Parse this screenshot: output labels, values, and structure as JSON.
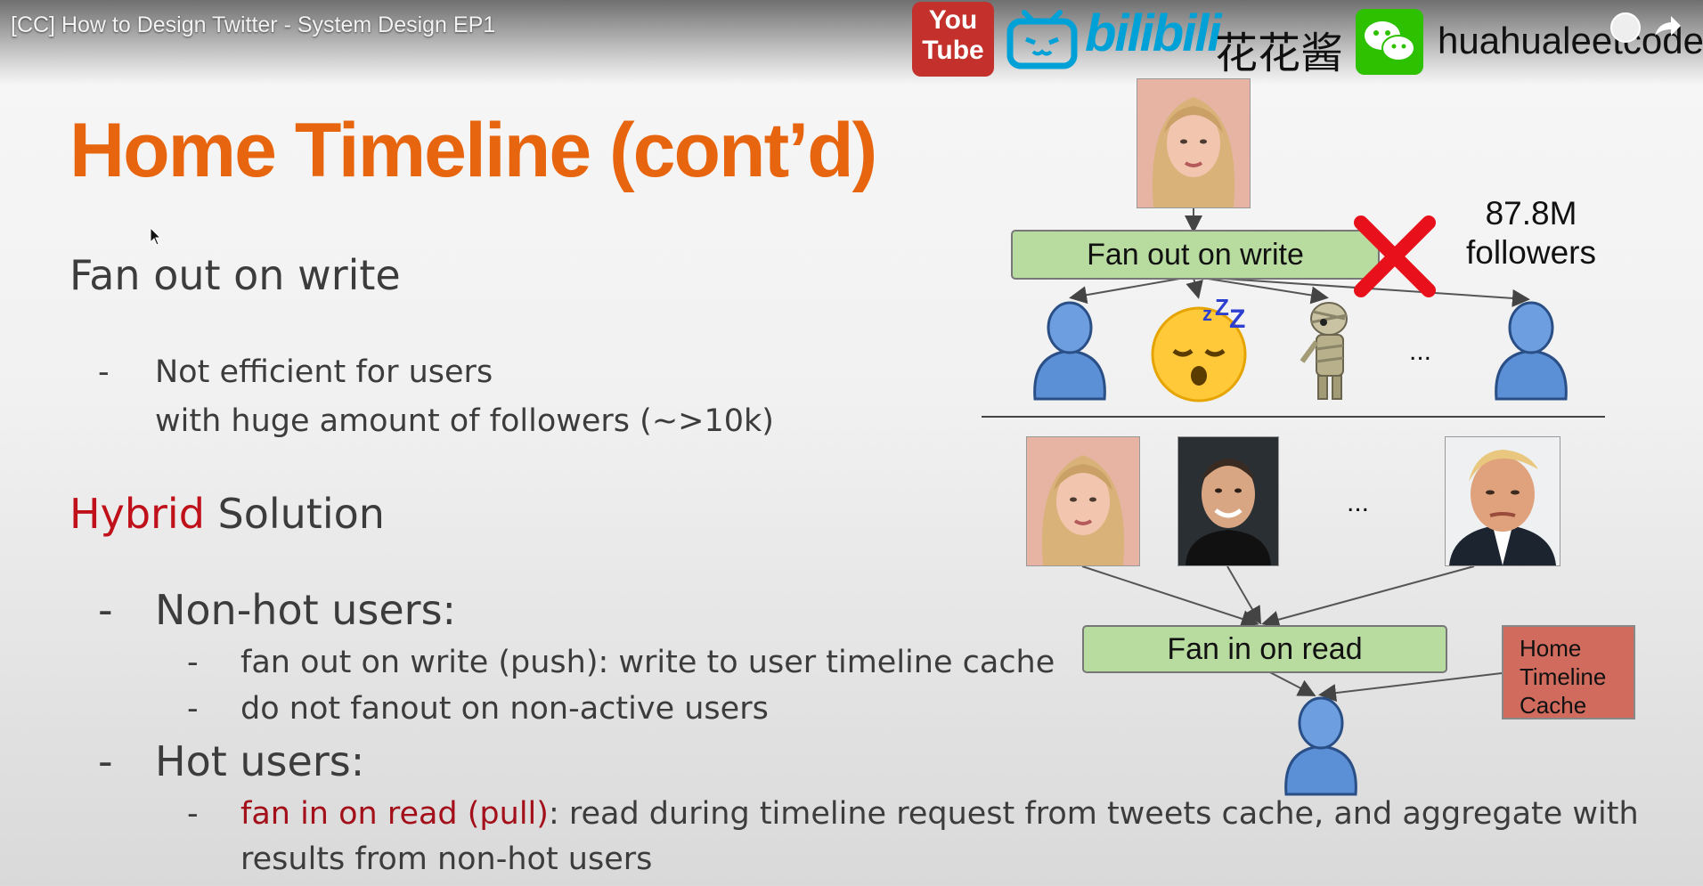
{
  "video": {
    "title": "[CC] How to Design Twitter - System Design EP1",
    "youtube_line1": "You",
    "youtube_line2": "Tube",
    "bilibili_text": "bilibili",
    "channel_cn": "花花酱",
    "handle": "huahualeetcode"
  },
  "slide": {
    "title": "Home Timeline (cont’d)",
    "section1": "Fan out on write",
    "dash": "-",
    "point1_line1": "Not efficient for users",
    "point1_line2": "with huge amount of followers (~>10k)",
    "section2_highlight": "Hybrid",
    "section2_rest": " Solution",
    "nonhot": "Non-hot users:",
    "nonhot_a": "fan out on write (push): write to user timeline cache",
    "nonhot_b": "do not fanout on non-active users",
    "hot": "Hot users:",
    "hot_a_highlight": "fan in on read (pull)",
    "hot_a_rest": ": read during timeline request from tweets cache, and aggregate with",
    "hot_a_line2": "results from non-hot users"
  },
  "diagram": {
    "fan_out_label": "Fan out on write",
    "followers_count": "87.8M",
    "followers_label": "followers",
    "ellipsis": "...",
    "fan_in_label": "Fan in on read",
    "cache_line1": "Home",
    "cache_line2": "Timeline",
    "cache_line3": "Cache"
  },
  "icons": [
    "youtube-logo",
    "bilibili-logo",
    "wechat-logo",
    "clock-icon",
    "share-icon",
    "cursor-icon",
    "user-icon",
    "sleeping-emoji-icon",
    "zombie-icon",
    "cross-icon"
  ],
  "colors": {
    "title": "#e8650f",
    "highlight": "#c0101a",
    "box_green": "#b8dca0",
    "cache_red": "#d06b5e",
    "user_blue": "#5b8fd6"
  }
}
